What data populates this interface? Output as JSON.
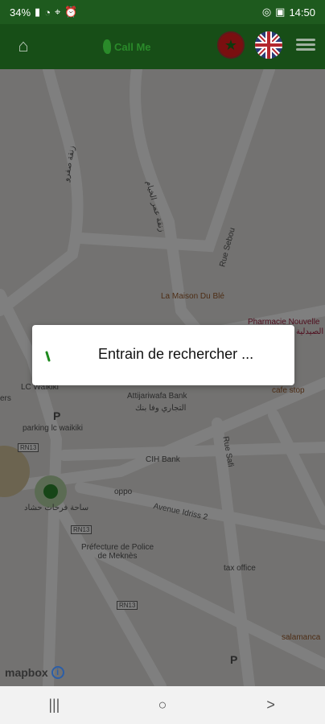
{
  "status_bar": {
    "battery": "34%",
    "time": "14:50"
  },
  "app_bar": {
    "brand_name": "Call Me"
  },
  "map": {
    "labels": [
      "زنقة صفرو",
      "زنقة عمر الخيام",
      "Rue Sebou",
      "La Maison Du Blé",
      "Pharmacie Nouvelle",
      "الصيدلية",
      "cafe stop",
      "LC Waikiki",
      "ers",
      "Attijariwafa Bank",
      "التجاري وفا بنك",
      "parking lc waikiki",
      "RN13",
      "CIH Bank",
      "oppo",
      "Rue Safi",
      "Avenue Idriss 2",
      "ساحة فرحات حشاد",
      "Préfecture de Police de Meknès",
      "tax office",
      "salamanca",
      "RN13",
      "RN13"
    ],
    "attribution": "mapbox",
    "attribution_info": "i"
  },
  "dialog": {
    "message": "Entrain de rechercher ..."
  },
  "nav_bar": {
    "recents": "|||",
    "home": "○",
    "back": ">"
  }
}
